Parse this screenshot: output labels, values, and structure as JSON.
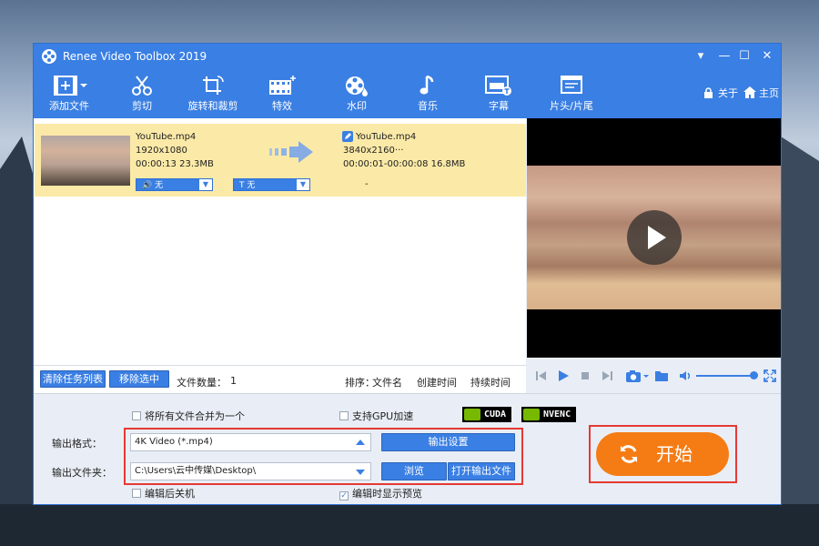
{
  "app": {
    "title": "Renee Video Toolbox 2019"
  },
  "window_controls": {
    "menu": "▾",
    "minimize": "—",
    "maximize": "☐",
    "close": "✕"
  },
  "toolbar": {
    "items": [
      {
        "label": "添加文件",
        "icon": "add-file-icon"
      },
      {
        "label": "剪切",
        "icon": "scissors-icon"
      },
      {
        "label": "旋转和裁剪",
        "icon": "crop-rotate-icon"
      },
      {
        "label": "特效",
        "icon": "film-effect-icon"
      },
      {
        "label": "水印",
        "icon": "watermark-reel-icon"
      },
      {
        "label": "音乐",
        "icon": "music-note-icon"
      },
      {
        "label": "字幕",
        "icon": "subtitle-icon"
      },
      {
        "label": "片头/片尾",
        "icon": "intro-outro-icon"
      }
    ],
    "lock_label": "关于",
    "home_label": "主页"
  },
  "file_item": {
    "source": {
      "name": "YouTube.mp4",
      "resolution": "1920x1080",
      "duration_size": "00:00:13 23.3MB"
    },
    "output": {
      "name": "YouTube.mp4",
      "resolution": "3840x2160",
      "extra": "···",
      "duration_size": "00:00:01-00:00:08 16.8MB"
    },
    "audio_select": "无",
    "subtitle_select": "无",
    "dash": "-"
  },
  "list_footer": {
    "clear_label": "清除任务列表",
    "remove_label": "移除选中",
    "file_count_label": "文件数量：",
    "file_count": "1",
    "sort_label": "排序：",
    "sort_name": "文件名",
    "sort_created": "创建时间",
    "sort_duration": "持续时间"
  },
  "options": {
    "merge_label": "将所有文件合并为一个",
    "merge_checked": false,
    "gpu_label": "支持GPU加速",
    "gpu_checked": false,
    "cuda_label": "CUDA",
    "nvenc_label": "NVENC",
    "shutdown_label": "编辑后关机",
    "shutdown_checked": false,
    "preview_label": "编辑时显示预览",
    "preview_checked": true,
    "check_mark": "✓"
  },
  "output": {
    "format_label": "输出格式：",
    "format_value": "4K Video (*.mp4)",
    "settings_button": "输出设置",
    "folder_label": "输出文件夹：",
    "folder_value": "C:\\Users\\云中传媒\\Desktop\\",
    "browse_button": "浏览",
    "open_folder_button": "打开输出文件"
  },
  "start": {
    "label": "开始"
  },
  "player": {
    "volume": 1.0
  },
  "colors": {
    "accent": "#3a7fe3",
    "start": "#f57c14",
    "highlight_row": "#fbeaa7",
    "red_frame": "#e53935"
  }
}
